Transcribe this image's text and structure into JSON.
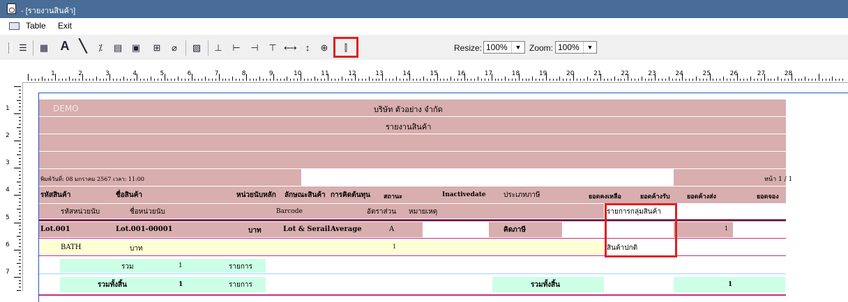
{
  "window": {
    "title": "- [รายงานสินค้า]"
  },
  "menu": {
    "items": [
      "Table",
      "Exit"
    ]
  },
  "toolbar": {
    "resize_label": "Resize:",
    "resize_value": "100%",
    "zoom_label": "Zoom:",
    "zoom_value": "100%",
    "buttons": [
      "arrange-icon",
      "table-icon",
      "text-icon",
      "line-icon",
      "formula-icon",
      "band-icon",
      "image-icon",
      "field-icon",
      "eraser-icon",
      "chart-icon",
      "group-icon",
      "align-left-icon",
      "align-right-icon",
      "align-top-icon",
      "width-icon",
      "height-icon",
      "center-icon",
      "insert-column-icon"
    ]
  },
  "ruler": {
    "marks": [
      "1",
      "2",
      "3",
      "4",
      "5",
      "6",
      "7",
      "8",
      "9",
      "10",
      "11",
      "12",
      "13",
      "14",
      "15",
      "16",
      "17",
      "18",
      "19",
      "20",
      "21",
      "22",
      "23",
      "24",
      "25",
      "26",
      "27",
      "28"
    ],
    "vmarks": [
      "1",
      "2",
      "3",
      "4",
      "5",
      "6",
      "7"
    ]
  },
  "report": {
    "watermark": "DEMO",
    "company": "บริษัท ตัวอย่าง จำกัด",
    "title": "รายงานสินค้า",
    "printed": "พิมพ์วันที่: 08 มกราคม 2567 เวลา: 11:00",
    "page": "หน้า 1 / 1",
    "header1": [
      "รหัสสินค้า",
      "ชื่อสินค้า",
      "หน่วยนับหลัก",
      "ลักษณะสินค้า",
      "การคิดต้นทุน",
      "สถานะ",
      "Inactivedate",
      "ประเภทภาษี",
      "ยอดคงเหลือ",
      "ยอดค้างรับ",
      "ยอดค้างส่ง",
      "ยอดจอง"
    ],
    "header2": [
      "รหัสหน่วยนับ",
      "ชื่อหน่วยนับ",
      "Barcode",
      "อัตราส่วน",
      "หมายเหตุ",
      "รายการกลุ่มสินค้า"
    ],
    "row1": {
      "code": "Lot.001",
      "name": "Lot.001-00001",
      "unit": "บาท",
      "type": "Lot & Serail",
      "cost": "Average",
      "status": "A",
      "tax": "คิดภาษี",
      "qty": "1"
    },
    "row2": {
      "unit_code": "BATH",
      "unit_name": "บาท",
      "ratio": "1",
      "group": "สินค้าปกติ"
    },
    "total": {
      "label": "รวม",
      "count": "1",
      "suffix": "รายการ"
    },
    "grand": {
      "label": "รวมทั้งสิ้น",
      "count": "1",
      "suffix": "รายการ",
      "label2": "รวมทั้งสิ้น",
      "qty": "1"
    }
  }
}
